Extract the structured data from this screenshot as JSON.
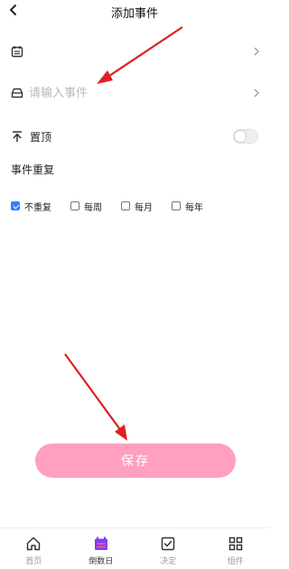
{
  "header": {
    "title": "添加事件"
  },
  "date_row": {},
  "event_row": {
    "placeholder": "请输入事件",
    "value": ""
  },
  "pin_row": {
    "label": "置顶",
    "enabled": false
  },
  "repeat": {
    "title": "事件重复",
    "options": [
      {
        "label": "不重复",
        "checked": true
      },
      {
        "label": "每周",
        "checked": false
      },
      {
        "label": "每月",
        "checked": false
      },
      {
        "label": "每年",
        "checked": false
      }
    ]
  },
  "save": {
    "label": "保存"
  },
  "tabbar": {
    "tabs": [
      {
        "label": "首页",
        "icon": "home-icon",
        "active": false
      },
      {
        "label": "倒数日",
        "icon": "calendar-icon",
        "active": true
      },
      {
        "label": "决定",
        "icon": "checkbox-icon",
        "active": false
      },
      {
        "label": "组件",
        "icon": "grid-icon",
        "active": false
      }
    ]
  },
  "colors": {
    "accent_pink": "#ff9fc2",
    "annotation_red": "#e02020",
    "checkbox_blue": "#3a7bff",
    "active_tab_purple": "#7b3ff2"
  }
}
